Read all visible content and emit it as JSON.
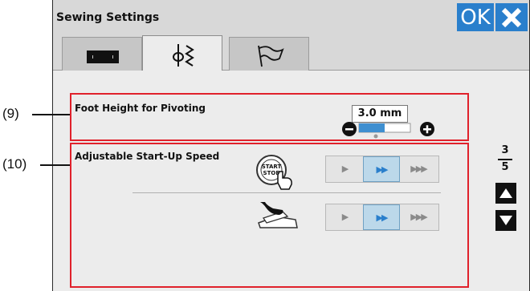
{
  "title": "Sewing Settings",
  "ok_label": "OK",
  "close_icon": "close-icon",
  "tabs": [
    {
      "name": "sewing-machine",
      "icon": "sewing-machine-icon",
      "active": false
    },
    {
      "name": "stitch-settings",
      "icon": "stitch-icon",
      "active": true
    },
    {
      "name": "language",
      "icon": "flag-icon",
      "active": false
    }
  ],
  "callouts": {
    "nine": "(9)",
    "ten": "(10)"
  },
  "foot_height": {
    "label": "Foot Height for Pivoting",
    "value": "3.0 mm",
    "slider_level": 0.5,
    "minus_icon": "minus-icon",
    "plus_icon": "plus-icon"
  },
  "startup_speed": {
    "label": "Adjustable Start-Up Speed",
    "rows": [
      {
        "icon": "start-stop-button-icon",
        "options": [
          "slow",
          "medium",
          "fast"
        ],
        "selected": "medium"
      },
      {
        "icon": "foot-control-icon",
        "options": [
          "slow",
          "medium",
          "fast"
        ],
        "selected": "medium"
      }
    ]
  },
  "pagination": {
    "current": "3",
    "total": "5"
  },
  "colors": {
    "accent": "#2a7fcc",
    "highlight": "#e0212b"
  }
}
